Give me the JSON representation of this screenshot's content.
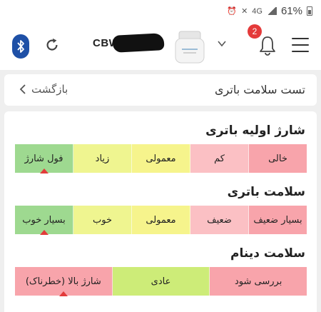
{
  "status_bar": {
    "battery_percent": "61%",
    "network": "4G"
  },
  "header": {
    "device_name": "CBW",
    "notification_count": "2"
  },
  "title_bar": {
    "title": "تست سلامت باتری",
    "back_label": "بازگشت"
  },
  "sections": [
    {
      "title": "شارژ اولیه باتری",
      "segments": [
        {
          "label": "خالی",
          "color": "#f8a4ab"
        },
        {
          "label": "کم",
          "color": "#fbc0c4"
        },
        {
          "label": "معمولی",
          "color": "#f6f48c"
        },
        {
          "label": "زیاد",
          "color": "#eff590"
        },
        {
          "label": "فول شارژ",
          "color": "#9ed990"
        }
      ],
      "active_index": 4
    },
    {
      "title": "سلامت باتری",
      "segments": [
        {
          "label": "بسیار ضعیف",
          "color": "#f8a4ab"
        },
        {
          "label": "ضعیف",
          "color": "#fbc0c4"
        },
        {
          "label": "معمولی",
          "color": "#f6f48c"
        },
        {
          "label": "خوب",
          "color": "#eff590"
        },
        {
          "label": "بسیار خوب",
          "color": "#9ed990"
        }
      ],
      "active_index": 4
    },
    {
      "title": "سلامت دینام",
      "segments": [
        {
          "label": "بررسی شود",
          "color": "#f8a4ab"
        },
        {
          "label": "عادی",
          "color": "#cdec78"
        },
        {
          "label": "شارژ بالا (خطرناک)",
          "color": "#f8a4ab"
        }
      ],
      "active_index": 2
    }
  ]
}
